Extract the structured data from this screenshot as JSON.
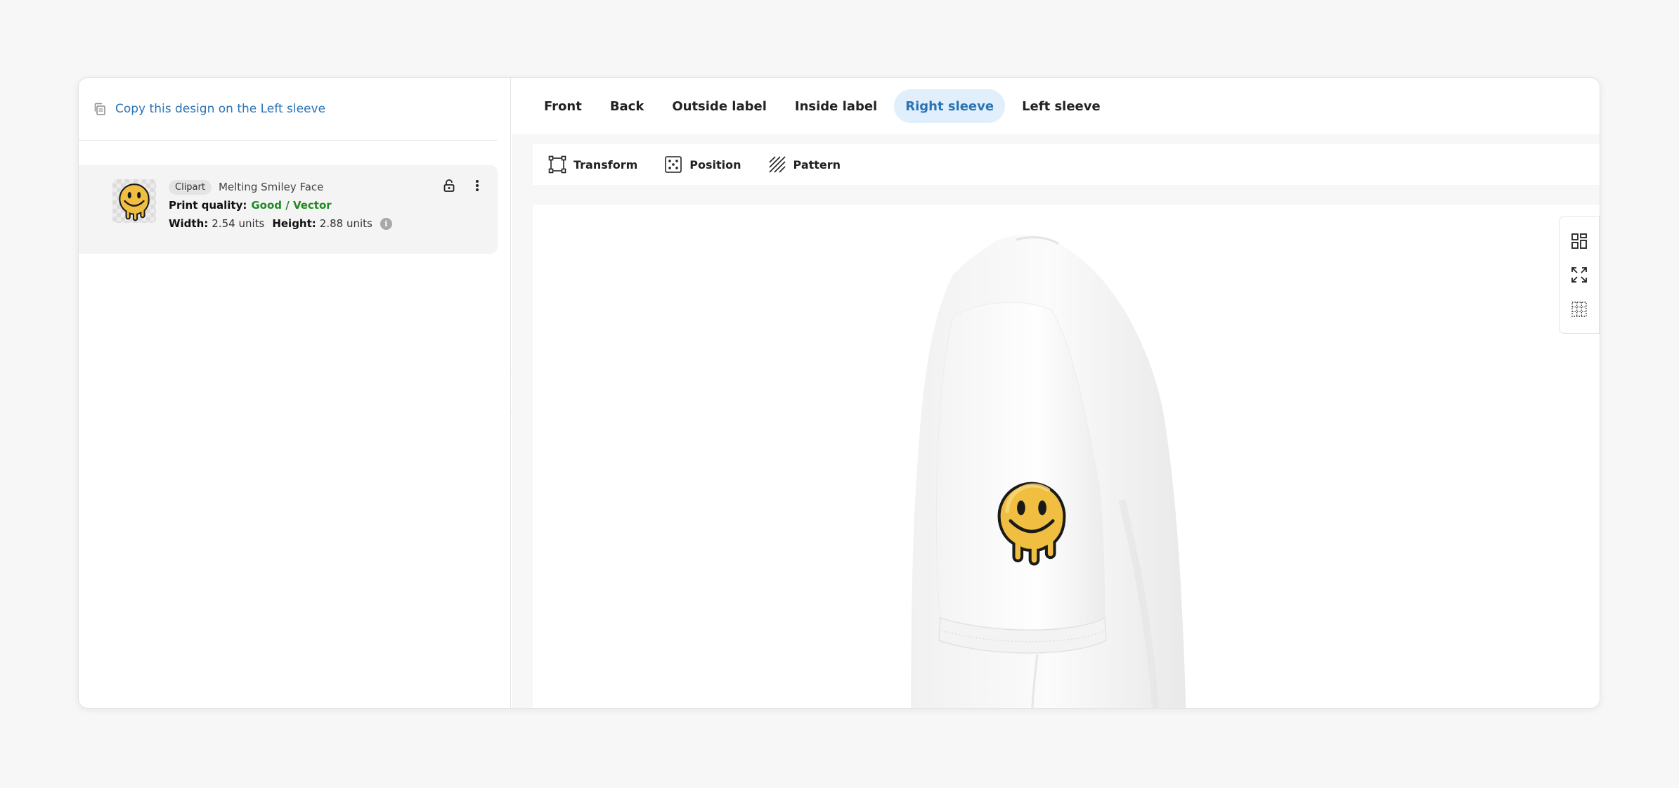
{
  "left_panel": {
    "copy_link": "Copy this design on the Left sleeve",
    "layer": {
      "badge": "Clipart",
      "name": "Melting Smiley Face",
      "print_quality_label": "Print quality:",
      "print_quality_value": "Good / Vector",
      "width_label": "Width:",
      "width_value": "2.54 units",
      "height_label": "Height:",
      "height_value": "2.88 units",
      "info_glyph": "i"
    },
    "collapse_glyph": "‹"
  },
  "tabs": [
    {
      "label": "Front",
      "active": false
    },
    {
      "label": "Back",
      "active": false
    },
    {
      "label": "Outside label",
      "active": false
    },
    {
      "label": "Inside label",
      "active": false
    },
    {
      "label": "Right sleeve",
      "active": true
    },
    {
      "label": "Left sleeve",
      "active": false
    }
  ],
  "toolbar": {
    "transform": "Transform",
    "position": "Position",
    "pattern": "Pattern"
  },
  "icons": {
    "copy": "copy-icon",
    "lock": "lock-icon",
    "more": "more-vertical-icon",
    "transform": "transform-icon",
    "position": "position-icon",
    "pattern": "pattern-icon",
    "layout": "layout-grid-icon",
    "fullscreen": "expand-icon",
    "grid": "dotted-grid-icon"
  },
  "colors": {
    "accent": "#2a74b5",
    "active_tab_bg": "#e0effb",
    "quality_good": "#1f8b24",
    "smiley": "#f0bf42"
  }
}
